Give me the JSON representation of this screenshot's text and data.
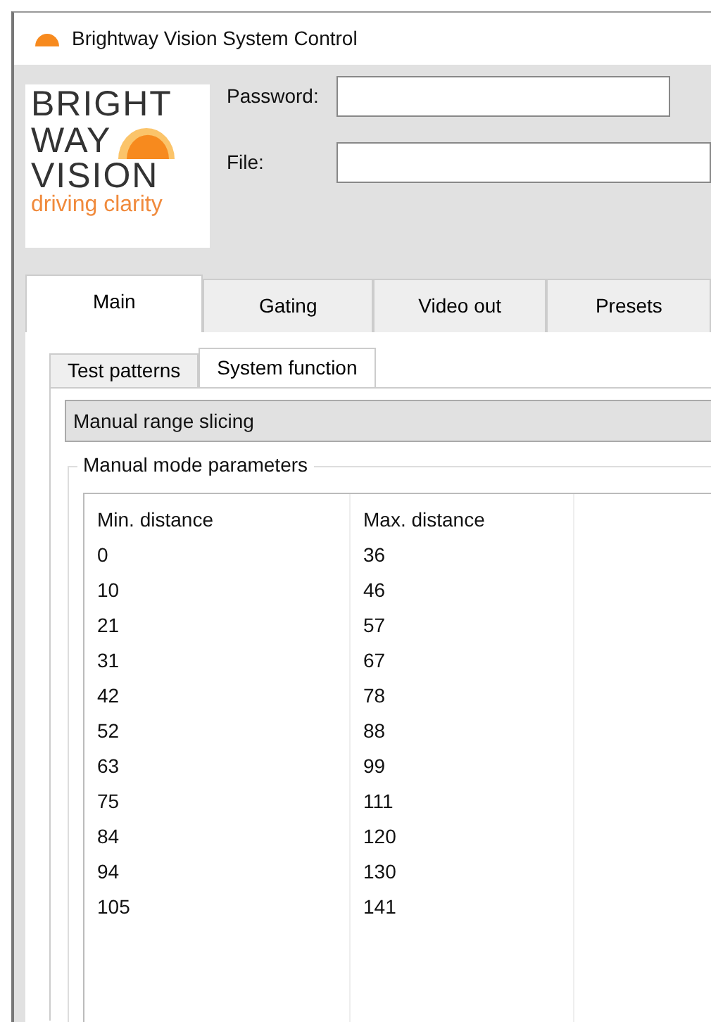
{
  "window": {
    "title": "Brightway Vision System Control"
  },
  "logo": {
    "lines": [
      "BRIGHT",
      "WAY",
      "VISION"
    ],
    "tagline": "driving clarity"
  },
  "fields": [
    {
      "label": "Password:"
    },
    {
      "label": "File:"
    }
  ],
  "tabs": [
    {
      "label": "Main",
      "selected": true
    },
    {
      "label": "Gating",
      "selected": false
    },
    {
      "label": "Video out",
      "selected": false
    },
    {
      "label": "Presets",
      "selected": false
    }
  ],
  "subtabs": [
    {
      "label": "Test patterns",
      "selected": false
    },
    {
      "label": "System function",
      "selected": true
    }
  ],
  "section": {
    "title": "Manual range slicing"
  },
  "group": {
    "title": "Manual mode parameters"
  },
  "table": {
    "columns": [
      "Min. distance",
      "Max. distance"
    ],
    "rows": [
      [
        "0",
        "36"
      ],
      [
        "10",
        "46"
      ],
      [
        "21",
        "57"
      ],
      [
        "31",
        "67"
      ],
      [
        "42",
        "78"
      ],
      [
        "52",
        "88"
      ],
      [
        "63",
        "99"
      ],
      [
        "75",
        "111"
      ],
      [
        "84",
        "120"
      ],
      [
        "94",
        "130"
      ],
      [
        "105",
        "141"
      ]
    ]
  }
}
